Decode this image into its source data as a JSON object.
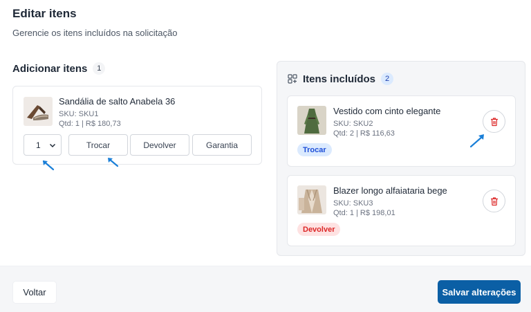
{
  "header": {
    "title": "Editar itens",
    "subtitle": "Gerencie os itens incluídos na solicitação"
  },
  "add_section": {
    "title": "Adicionar itens",
    "count": "1",
    "product": {
      "name": "Sandália de salto Anabela 36",
      "sku": "SKU: SKU1",
      "qty_price": "Qtd: 1 | R$ 180,73",
      "thumb_icon": "sandal-icon"
    },
    "quantity_value": "1",
    "actions": [
      "Trocar",
      "Devolver",
      "Garantia"
    ]
  },
  "included_section": {
    "title": "Itens incluídos",
    "count": "2",
    "icon": "grid-plus-icon",
    "items": [
      {
        "name": "Vestido com cinto elegante",
        "sku": "SKU: SKU2",
        "qty_price": "Qtd: 2 | R$ 116,63",
        "tag": "Trocar",
        "thumb_icon": "dress-icon"
      },
      {
        "name": "Blazer longo alfaiataria bege",
        "sku": "SKU: SKU3",
        "qty_price": "Qtd: 1 | R$ 198,01",
        "tag": "Devolver",
        "thumb_icon": "blazer-icon"
      }
    ]
  },
  "footer": {
    "back_label": "Voltar",
    "save_label": "Salvar alterações"
  },
  "colors": {
    "primary": "#0b5fa5",
    "trocar_tag_bg": "#dbeafe",
    "trocar_tag_text": "#1d4ed8",
    "devolver_tag_bg": "#fee2e2",
    "devolver_tag_text": "#dc2626",
    "trash": "#dc2626",
    "annotation_arrow": "#1a7fd8"
  }
}
